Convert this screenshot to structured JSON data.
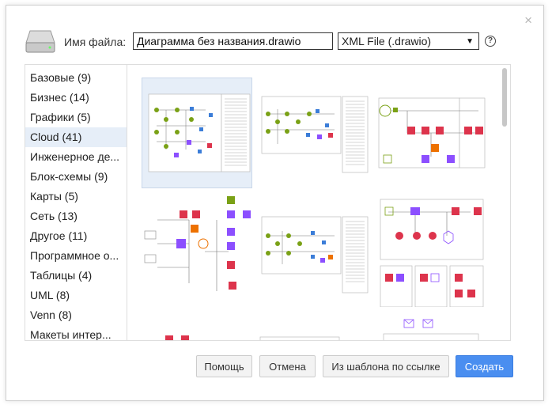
{
  "dialog": {
    "filename_label": "Имя файла:",
    "filename_value": "Диаграмма без названия.drawio",
    "format_selected": "XML File (.drawio)"
  },
  "categories": [
    {
      "label": "Базовые (9)"
    },
    {
      "label": "Бизнес (14)"
    },
    {
      "label": "Графики (5)"
    },
    {
      "label": "Cloud (41)"
    },
    {
      "label": "Инженерное де..."
    },
    {
      "label": "Блок-схемы (9)"
    },
    {
      "label": "Карты (5)"
    },
    {
      "label": "Сеть (13)"
    },
    {
      "label": "Другое (11)"
    },
    {
      "label": "Программное о..."
    },
    {
      "label": "Таблицы (4)"
    },
    {
      "label": "UML (8)"
    },
    {
      "label": "Venn (8)"
    },
    {
      "label": "Макеты интер..."
    }
  ],
  "buttons": {
    "help": "Помощь",
    "cancel": "Отмена",
    "from_url": "Из шаблона по ссылке",
    "create": "Создать"
  },
  "colors": {
    "accent": "#4a8ef0",
    "selected_bg": "#e6eef8",
    "aws_green": "#7aa116",
    "aws_red": "#dd344c",
    "aws_purple": "#8c4fff",
    "aws_orange": "#ed7100"
  }
}
